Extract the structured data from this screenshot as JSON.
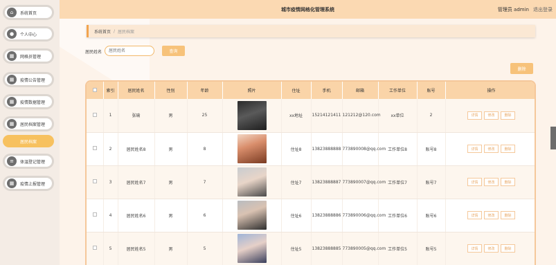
{
  "header": {
    "title": "城市疫情网格化管理系统",
    "user": "管理员 admin",
    "logout": "退出登录"
  },
  "sidebar": {
    "items": [
      {
        "label": "系统首页",
        "icon": "home-icon",
        "glyph": "⌂"
      },
      {
        "label": "个人中心",
        "icon": "user-icon",
        "glyph": "●"
      },
      {
        "label": "网格员管理",
        "icon": "grid-icon",
        "glyph": "▦"
      },
      {
        "label": "疫情公告管理",
        "icon": "grid-icon",
        "glyph": "▦"
      },
      {
        "label": "疫情数据管理",
        "icon": "grid-icon",
        "glyph": "▦"
      },
      {
        "label": "居民档案管理",
        "icon": "grid-icon",
        "glyph": "▦"
      },
      {
        "label": "居民档案",
        "icon": "",
        "glyph": ""
      },
      {
        "label": "体温登记管理",
        "icon": "list-icon",
        "glyph": "≡"
      },
      {
        "label": "疫情上报管理",
        "icon": "grid-icon",
        "glyph": "▦"
      }
    ]
  },
  "breadcrumb": {
    "home": "系统首页",
    "sep": "/",
    "current": "居民档案"
  },
  "search": {
    "label": "居民姓名",
    "placeholder": "居民姓名",
    "button": "查询"
  },
  "delete_button": "删除",
  "table": {
    "columns": [
      "索引",
      "居民姓名",
      "性别",
      "年龄",
      "照片",
      "住址",
      "手机",
      "邮箱",
      "工作单位",
      "账号",
      "操作"
    ],
    "rows": [
      {
        "index": "1",
        "name": "张瑜",
        "gender": "男",
        "age": "25",
        "address": "xx地址",
        "phone": "15214121411",
        "email": "121212@120.com",
        "work": "xx单位",
        "account": "2"
      },
      {
        "index": "2",
        "name": "居民姓名8",
        "gender": "男",
        "age": "8",
        "address": "住址8",
        "phone": "13823888888",
        "email": "773890008@qq.com",
        "work": "工作单位8",
        "account": "账号8"
      },
      {
        "index": "3",
        "name": "居民姓名7",
        "gender": "男",
        "age": "7",
        "address": "住址7",
        "phone": "13823888887",
        "email": "773890007@qq.com",
        "work": "工作单位7",
        "account": "账号7"
      },
      {
        "index": "4",
        "name": "居民姓名6",
        "gender": "男",
        "age": "6",
        "address": "住址6",
        "phone": "13823888886",
        "email": "773890006@qq.com",
        "work": "工作单位6",
        "account": "账号6"
      },
      {
        "index": "5",
        "name": "居民姓名5",
        "gender": "男",
        "age": "5",
        "address": "住址5",
        "phone": "13823888885",
        "email": "773890005@qq.com",
        "work": "工作单位5",
        "account": "账号5"
      }
    ],
    "ops": {
      "detail": "详情",
      "edit": "修改",
      "delete": "删除"
    }
  },
  "colors": {
    "accent": "#f7c15f",
    "header_bg": "#fbd9b2",
    "table_head": "#fad4a8"
  }
}
